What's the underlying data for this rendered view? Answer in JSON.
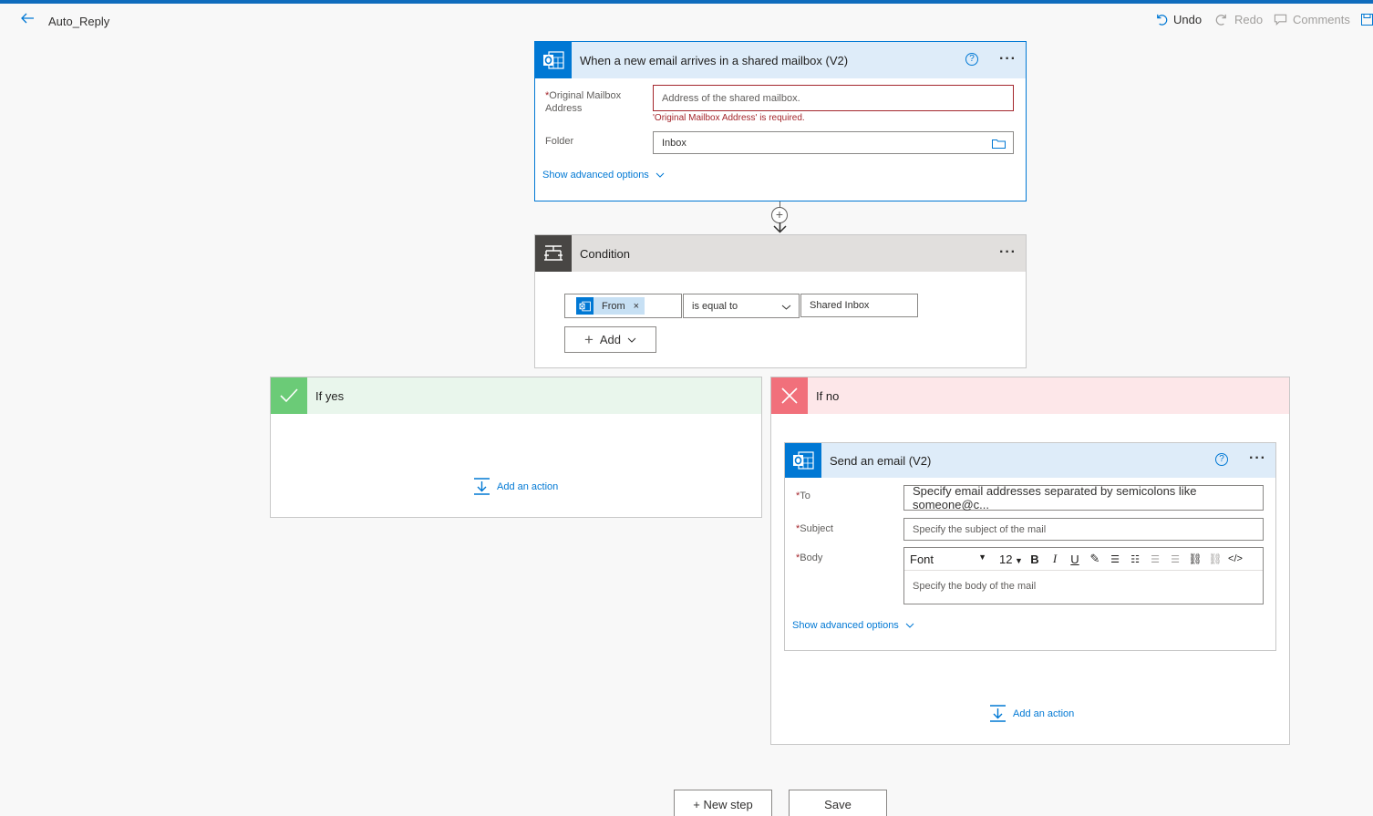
{
  "header": {
    "flow_name": "Auto_Reply",
    "undo_label": "Undo",
    "redo_label": "Redo",
    "comments_label": "Comments"
  },
  "trigger": {
    "title": "When a new email arrives in a shared mailbox (V2)",
    "help": "?",
    "mailbox_label": "Original Mailbox Address",
    "mailbox_placeholder": "Address of the shared mailbox.",
    "mailbox_error": "'Original Mailbox Address' is required.",
    "folder_label": "Folder",
    "folder_value": "Inbox",
    "advanced_label": "Show advanced options"
  },
  "condition": {
    "title": "Condition",
    "token_label": "From",
    "operator": "is equal to",
    "value": "Shared Inbox",
    "add_label": "Add"
  },
  "branch_yes": {
    "title": "If yes",
    "add_action_label": "Add an action"
  },
  "branch_no": {
    "title": "If no",
    "add_action_label": "Add an action"
  },
  "send_email": {
    "title": "Send an email (V2)",
    "help": "?",
    "to_label": "To",
    "to_placeholder": "Specify email addresses separated by semicolons like someone@c...",
    "subject_label": "Subject",
    "subject_placeholder": "Specify the subject of the mail",
    "body_label": "Body",
    "font_value": "Font",
    "size_value": "12",
    "body_placeholder": "Specify the body of the mail",
    "advanced_label": "Show advanced options"
  },
  "footer": {
    "new_step_label": "+ New step",
    "save_label": "Save"
  },
  "colors": {
    "accent": "#0078d4",
    "trigger_header": "#deecf9",
    "condition_header": "#e1dfdd",
    "condition_icon_bg": "#484644",
    "yes_header": "#e9f6ec",
    "yes_icon_bg": "#6bcb77",
    "no_header": "#fde7e9",
    "no_icon_bg": "#f1707b",
    "error": "#a4262c"
  }
}
